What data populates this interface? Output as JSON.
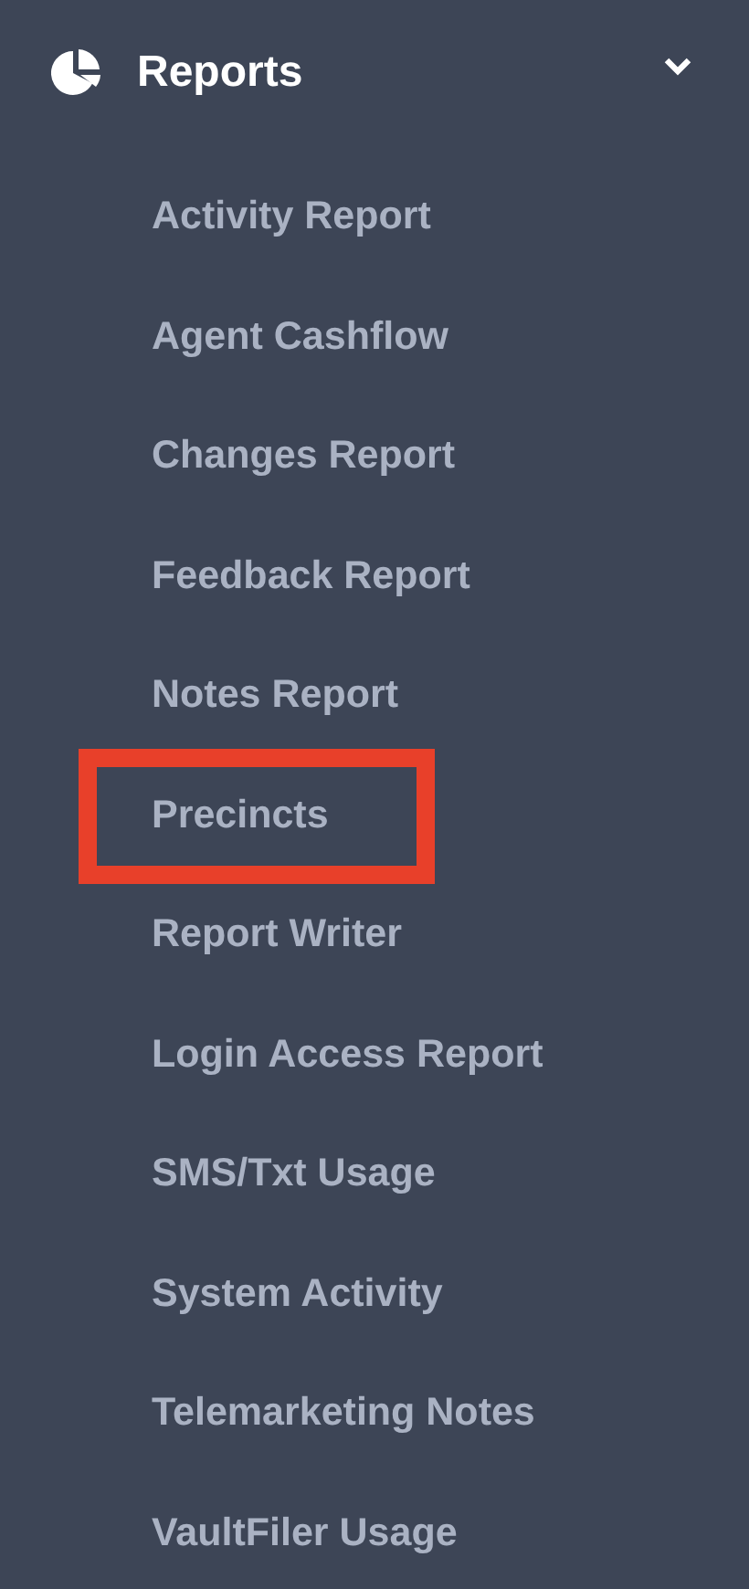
{
  "section": {
    "title": "Reports",
    "expanded": true
  },
  "items": [
    {
      "label": "Activity Report",
      "highlighted": false
    },
    {
      "label": "Agent Cashflow",
      "highlighted": false
    },
    {
      "label": "Changes Report",
      "highlighted": false
    },
    {
      "label": "Feedback Report",
      "highlighted": false
    },
    {
      "label": "Notes Report",
      "highlighted": false
    },
    {
      "label": "Precincts",
      "highlighted": true
    },
    {
      "label": "Report Writer",
      "highlighted": false
    },
    {
      "label": "Login Access Report",
      "highlighted": false
    },
    {
      "label": "SMS/Txt Usage",
      "highlighted": false
    },
    {
      "label": "System Activity",
      "highlighted": false
    },
    {
      "label": "Telemarketing Notes",
      "highlighted": false
    },
    {
      "label": "VaultFiler Usage",
      "highlighted": false
    }
  ]
}
